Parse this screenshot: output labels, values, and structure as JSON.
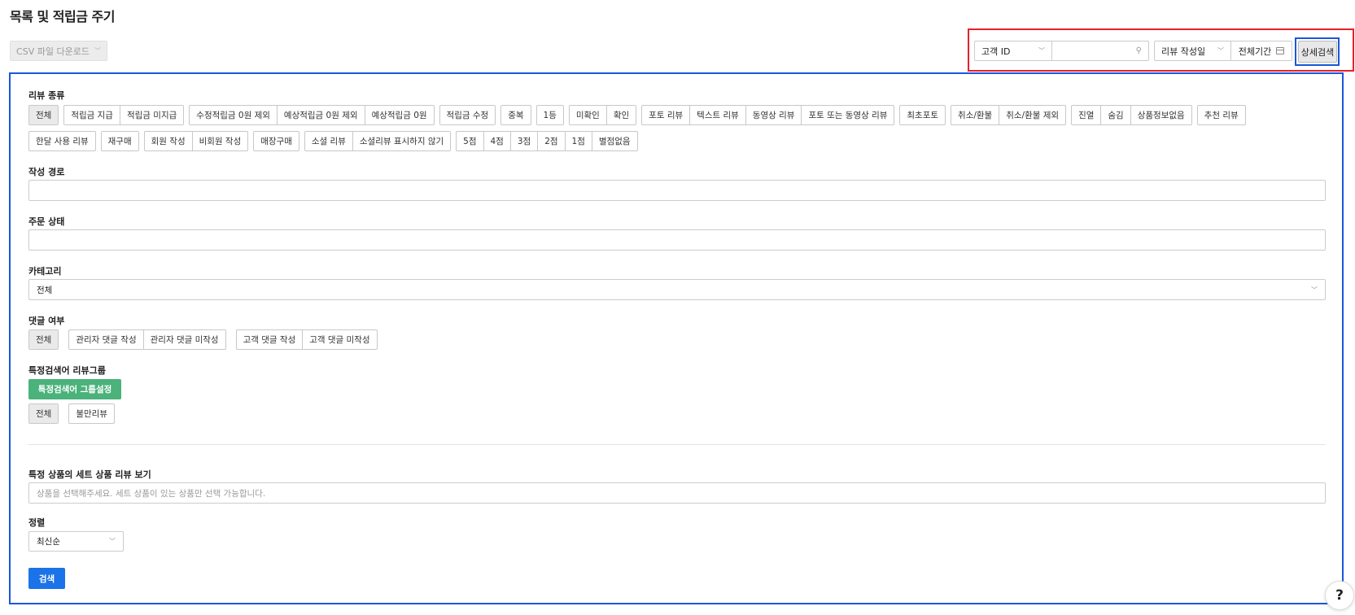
{
  "page": {
    "title": "목록 및 적립금 주기"
  },
  "toolbar": {
    "csv_download": "CSV 파일 다운로드",
    "search_type": "고객 ID",
    "search_value": "",
    "date_type": "리뷰 작성일",
    "date_period": "전체기간",
    "detail_search": "상세검색"
  },
  "review_type": {
    "label": "리뷰 종류",
    "row1": [
      {
        "group": [
          "전체"
        ],
        "active": 0
      },
      {
        "group": [
          "적립금 지급",
          "적립금 미지급"
        ]
      },
      {
        "group": [
          "수정적립금 0원 제외",
          "예상적립금 0원 제외",
          "예상적립금 0원"
        ]
      },
      {
        "group": [
          "적립금 수정"
        ]
      },
      {
        "group": [
          "중복"
        ]
      },
      {
        "group": [
          "1등"
        ]
      },
      {
        "group": [
          "미확인",
          "확인"
        ]
      },
      {
        "group": [
          "포토 리뷰",
          "텍스트 리뷰",
          "동영상 리뷰",
          "포토 또는 동영상 리뷰"
        ]
      },
      {
        "group": [
          "최초포토"
        ]
      },
      {
        "group": [
          "취소/환불",
          "취소/환불 제외"
        ]
      },
      {
        "group": [
          "진열",
          "숨김",
          "상품정보없음"
        ]
      },
      {
        "group": [
          "추천 리뷰"
        ]
      }
    ],
    "row2": [
      {
        "group": [
          "한달 사용 리뷰"
        ]
      },
      {
        "group": [
          "재구매"
        ]
      },
      {
        "group": [
          "회원 작성",
          "비회원 작성"
        ]
      },
      {
        "group": [
          "매장구매"
        ]
      },
      {
        "group": [
          "소셜 리뷰",
          "소셜리뷰 표시하지 않기"
        ]
      },
      {
        "group": [
          "5점",
          "4점",
          "3점",
          "2점",
          "1점",
          "별점없음"
        ]
      }
    ]
  },
  "write_path": {
    "label": "작성 경로",
    "value": ""
  },
  "order_status": {
    "label": "주문 상태",
    "value": ""
  },
  "category": {
    "label": "카테고리",
    "value": "전체"
  },
  "reply": {
    "label": "댓글 여부",
    "groups": [
      [
        "전체"
      ],
      [
        "관리자 댓글 작성",
        "관리자 댓글 미작성"
      ],
      [
        "고객 댓글 작성",
        "고객 댓글 미작성"
      ]
    ]
  },
  "keyword_group": {
    "label": "특정검색어 리뷰그룹",
    "setting_button": "특정검색어 그룹설정",
    "groups": [
      [
        "전체"
      ],
      [
        "불만리뷰"
      ]
    ]
  },
  "set_product": {
    "label": "특정 상품의 세트 상품 리뷰 보기",
    "placeholder": "상품을 선택해주세요. 세트 상품이 있는 상품만 선택 가능합니다."
  },
  "sort": {
    "label": "정렬",
    "value": "최신순"
  },
  "search_button": "검색",
  "help": "?"
}
